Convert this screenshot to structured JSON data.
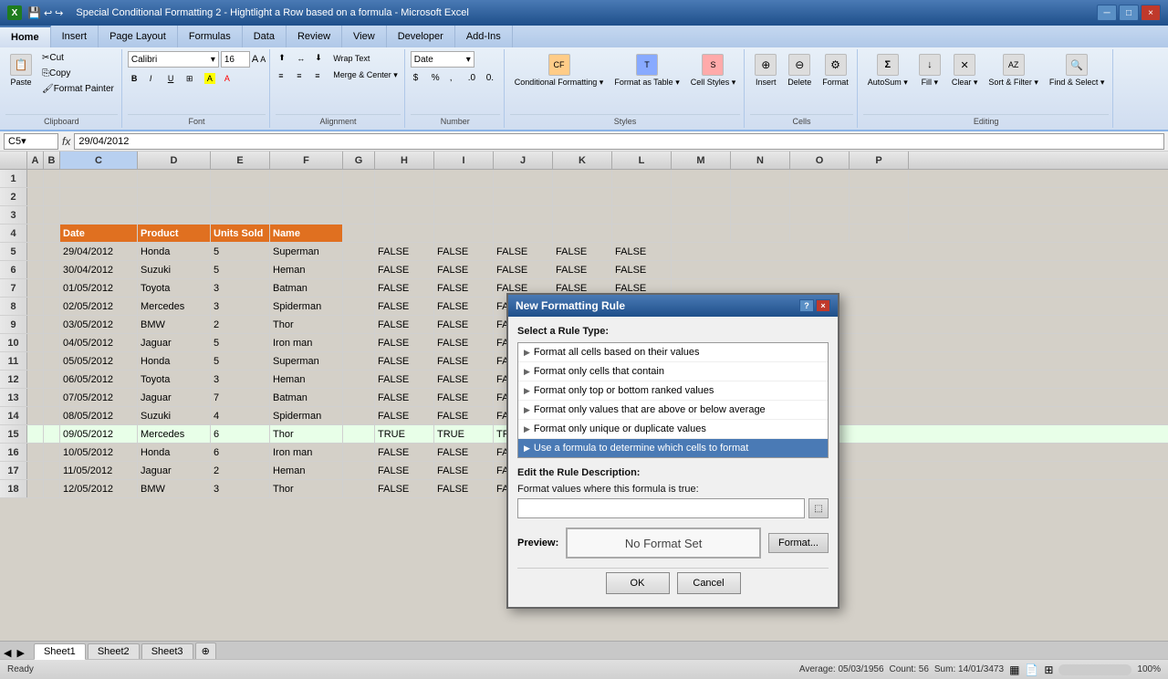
{
  "titleBar": {
    "title": "Special Conditional Formatting 2 - Hightlight a Row based on a formula - Microsoft Excel",
    "closeBtn": "×",
    "maxBtn": "□",
    "minBtn": "─"
  },
  "ribbonTabs": [
    {
      "label": "Home",
      "active": true
    },
    {
      "label": "Insert",
      "active": false
    },
    {
      "label": "Page Layout",
      "active": false
    },
    {
      "label": "Formulas",
      "active": false
    },
    {
      "label": "Data",
      "active": false
    },
    {
      "label": "Review",
      "active": false
    },
    {
      "label": "View",
      "active": false
    },
    {
      "label": "Developer",
      "active": false
    },
    {
      "label": "Add-Ins",
      "active": false
    }
  ],
  "fontName": "Calibri",
  "fontSize": "16",
  "formulaBar": {
    "nameBox": "C5",
    "formula": "29/04/2012"
  },
  "columns": [
    "A",
    "B",
    "C",
    "D",
    "E",
    "F",
    "G",
    "H",
    "I",
    "J",
    "K",
    "L",
    "M",
    "N",
    "O",
    "P"
  ],
  "tableHeaders": {
    "date": "Date",
    "product": "Product",
    "unitsSold": "Units Sold",
    "name": "Name"
  },
  "rows": [
    {
      "row": 1,
      "cells": []
    },
    {
      "row": 2,
      "cells": []
    },
    {
      "row": 3,
      "cells": []
    },
    {
      "row": 4,
      "date": "Date",
      "product": "Product",
      "units": "Units Sold",
      "name": "Name",
      "isHeader": true
    },
    {
      "row": 5,
      "date": "29/04/2012",
      "product": "Honda",
      "units": "5",
      "name": "Superman"
    },
    {
      "row": 6,
      "date": "30/04/2012",
      "product": "Suzuki",
      "units": "5",
      "name": "Heman"
    },
    {
      "row": 7,
      "date": "01/05/2012",
      "product": "Toyota",
      "units": "3",
      "name": "Batman"
    },
    {
      "row": 8,
      "date": "02/05/2012",
      "product": "Mercedes",
      "units": "3",
      "name": "Spiderman"
    },
    {
      "row": 9,
      "date": "03/05/2012",
      "product": "BMW",
      "units": "2",
      "name": "Thor"
    },
    {
      "row": 10,
      "date": "04/05/2012",
      "product": "Jaguar",
      "units": "5",
      "name": "Iron man"
    },
    {
      "row": 11,
      "date": "05/05/2012",
      "product": "Honda",
      "units": "5",
      "name": "Superman"
    },
    {
      "row": 12,
      "date": "06/05/2012",
      "product": "Toyota",
      "units": "3",
      "name": "Heman"
    },
    {
      "row": 13,
      "date": "07/05/2012",
      "product": "Jaguar",
      "units": "7",
      "name": "Batman"
    },
    {
      "row": 14,
      "date": "08/05/2012",
      "product": "Suzuki",
      "units": "4",
      "name": "Spiderman"
    },
    {
      "row": 15,
      "date": "09/05/2012",
      "product": "Mercedes",
      "units": "6",
      "name": "Thor"
    },
    {
      "row": 16,
      "date": "10/05/2012",
      "product": "Honda",
      "units": "6",
      "name": "Iron man"
    },
    {
      "row": 17,
      "date": "11/05/2012",
      "product": "Jaguar",
      "units": "2",
      "name": "Heman"
    },
    {
      "row": 18,
      "date": "12/05/2012",
      "product": "BMW",
      "units": "3",
      "name": "Thor"
    }
  ],
  "boolCols": {
    "row5": [
      "FALSE",
      "FALSE",
      "FALSE",
      "FALSE",
      "FALSE"
    ],
    "row6": [
      "FALSE",
      "FALSE",
      "FALSE",
      "FALSE",
      "FALSE"
    ],
    "row7": [
      "FALSE",
      "FALSE",
      "FALSE",
      "FALSE",
      "FALSE"
    ],
    "row8": [
      "FALSE",
      "FALSE",
      "FALSE",
      "FALSE",
      "FALSE"
    ],
    "row9": [
      "FALSE",
      "FALSE",
      "FALSE",
      "FALSE",
      "FALSE"
    ],
    "row10": [
      "FALSE",
      "FALSE",
      "FALSE",
      "FALSE",
      "FALSE"
    ],
    "row11": [
      "FALSE",
      "FALSE",
      "FALSE",
      "FALSE",
      "FALSE"
    ],
    "row12": [
      "FALSE",
      "FALSE",
      "FALSE",
      "FALSE",
      "FALSE"
    ],
    "row13": [
      "FALSE",
      "FALSE",
      "FALSE",
      "FALSE",
      "FALSE"
    ],
    "row14": [
      "FALSE",
      "FALSE",
      "FALSE",
      "FALSE",
      "FALSE"
    ],
    "row15": [
      "TRUE",
      "TRUE",
      "TRUE",
      "TRUE",
      "TRUE"
    ],
    "row16": [
      "FALSE",
      "FALSE",
      "FALSE",
      "FALSE",
      "FALSE"
    ],
    "row17": [
      "FALSE",
      "FALSE",
      "FALSE",
      "FALSE",
      "FALSE"
    ],
    "row18": [
      "FALSE",
      "FALSE",
      "FALSE",
      "FALSE",
      "FALSE"
    ]
  },
  "dialog": {
    "title": "New Formatting Rule",
    "sectionTitle": "Select a Rule Type:",
    "rules": [
      {
        "label": "Format all cells based on their values",
        "selected": false
      },
      {
        "label": "Format only cells that contain",
        "selected": false
      },
      {
        "label": "Format only top or bottom ranked values",
        "selected": false
      },
      {
        "label": "Format only values that are above or below average",
        "selected": false
      },
      {
        "label": "Format only unique or duplicate values",
        "selected": false
      },
      {
        "label": "Use a formula to determine which cells to format",
        "selected": true
      }
    ],
    "editSectionTitle": "Edit the Rule Description:",
    "formulaLabel": "Format values where this formula is true:",
    "previewLabel": "Preview:",
    "noFormatText": "No Format Set",
    "formatBtnLabel": "Format...",
    "okLabel": "OK",
    "cancelLabel": "Cancel"
  },
  "sheetTabs": [
    {
      "label": "Sheet1",
      "active": true
    },
    {
      "label": "Sheet2",
      "active": false
    },
    {
      "label": "Sheet3",
      "active": false
    }
  ],
  "statusBar": {
    "status": "Ready",
    "average": "Average: 05/03/1956",
    "count": "Count: 56",
    "sum": "Sum: 14/01/3473",
    "zoom": "100%"
  }
}
